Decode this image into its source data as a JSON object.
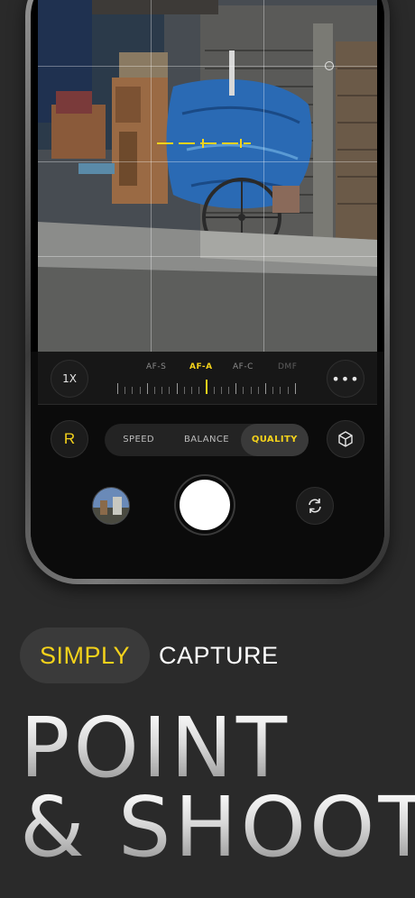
{
  "camera": {
    "zoom_label": "1X",
    "more_label": "•••",
    "af_modes": [
      {
        "label": "AF-S",
        "active": false
      },
      {
        "label": "AF-A",
        "active": true
      },
      {
        "label": "AF-C",
        "active": false
      },
      {
        "label": "DMF",
        "active": false
      }
    ],
    "raw_label": "R",
    "quality_modes": [
      {
        "label": "SPEED",
        "active": false
      },
      {
        "label": "BALANCE",
        "active": false
      },
      {
        "label": "QUALITY",
        "active": true
      }
    ],
    "icons": {
      "cube": "cube-icon",
      "flip": "flip-camera-icon",
      "thumbnail": "last-photo-thumbnail"
    },
    "accent_color": "#f4d21b"
  },
  "marketing": {
    "tag_highlight": "SIMPLY",
    "tag_rest": "CAPTURE",
    "headline_line1": "POINT",
    "headline_line2": "& SHOOT"
  }
}
